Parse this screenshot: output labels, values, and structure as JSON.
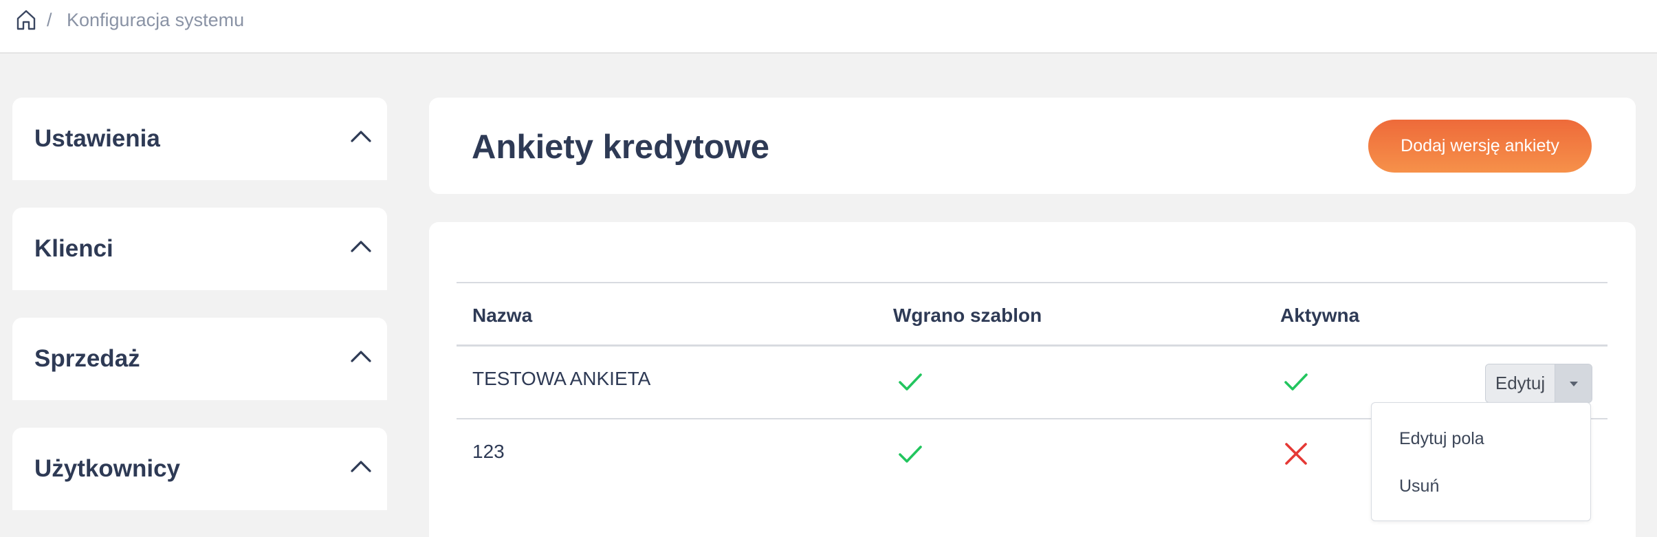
{
  "breadcrumb": {
    "home_icon": "home-icon",
    "separator": "/",
    "current": "Konfiguracja systemu"
  },
  "sidebar": {
    "sections": [
      {
        "label": "Ustawienia",
        "icon": "chevron-up-icon"
      },
      {
        "label": "Klienci",
        "icon": "chevron-up-icon"
      },
      {
        "label": "Sprzedaż",
        "icon": "chevron-up-icon"
      },
      {
        "label": "Użytkownicy",
        "icon": "chevron-up-icon"
      }
    ]
  },
  "header": {
    "title": "Ankiety kredytowe",
    "add_button": "Dodaj wersję ankiety"
  },
  "table": {
    "columns": [
      "Nazwa",
      "Wgrano szablon",
      "Aktywna"
    ],
    "rows": [
      {
        "name": "TESTOWA ANKIETA",
        "template_uploaded": true,
        "active": true
      },
      {
        "name": "123",
        "template_uploaded": true,
        "active": false
      }
    ],
    "row_action": {
      "label": "Edytuj",
      "toggle_icon": "caret-down-icon"
    }
  },
  "dropdown_menu": {
    "items": [
      "Edytuj pola",
      "Usuń"
    ]
  },
  "colors": {
    "accent_orange": "#f07a3e",
    "check_green": "#22c55e",
    "cross_red": "#e53935",
    "text_dark": "#2e3a55"
  }
}
